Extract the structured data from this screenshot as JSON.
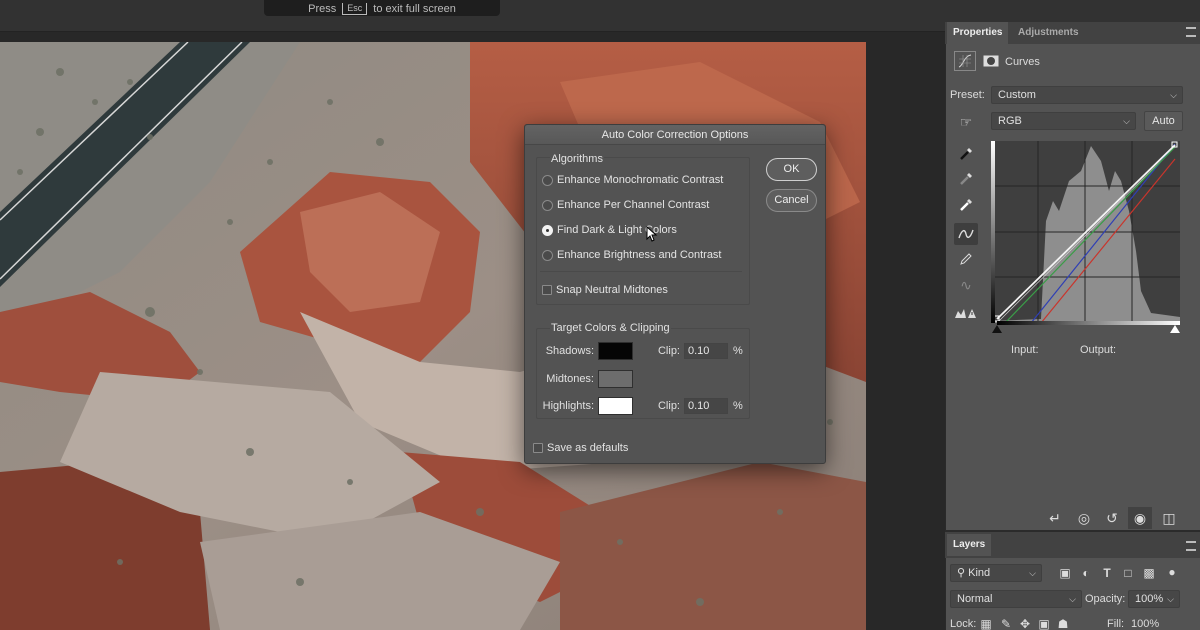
{
  "fullscreen_hint": {
    "prefix": "Press",
    "key": "Esc",
    "suffix": "to exit full screen"
  },
  "dialog": {
    "title": "Auto Color Correction Options",
    "algorithms_title": "Algorithms",
    "algorithms": [
      {
        "label": "Enhance Monochromatic Contrast",
        "selected": false
      },
      {
        "label": "Enhance Per Channel Contrast",
        "selected": false
      },
      {
        "label": "Find Dark & Light Colors",
        "selected": true
      },
      {
        "label": "Enhance Brightness and Contrast",
        "selected": false
      }
    ],
    "snap_label": "Snap Neutral Midtones",
    "snap_checked": false,
    "target_title": "Target Colors & Clipping",
    "shadows_label": "Shadows:",
    "midtones_label": "Midtones:",
    "highlights_label": "Highlights:",
    "clip_label": "Clip:",
    "shadows_clip": "0.10",
    "highlights_clip": "0.10",
    "percent": "%",
    "shadows_color": "#050505",
    "midtones_color": "#6d6d6d",
    "highlights_color": "#ffffff",
    "save_defaults_label": "Save as defaults",
    "save_defaults_checked": false,
    "ok_label": "OK",
    "cancel_label": "Cancel"
  },
  "properties": {
    "tab_properties": "Properties",
    "tab_adjustments": "Adjustments",
    "adjustment_name": "Curves",
    "preset_label": "Preset:",
    "preset_value": "Custom",
    "channel_value": "RGB",
    "auto_label": "Auto",
    "input_label": "Input:",
    "output_label": "Output:"
  },
  "layers": {
    "tab_label": "Layers",
    "filter_value": "Kind",
    "blend_mode": "Normal",
    "opacity_label": "Opacity:",
    "opacity_value": "100%",
    "lock_label": "Lock:",
    "fill_label": "Fill:",
    "fill_value": "100%"
  }
}
